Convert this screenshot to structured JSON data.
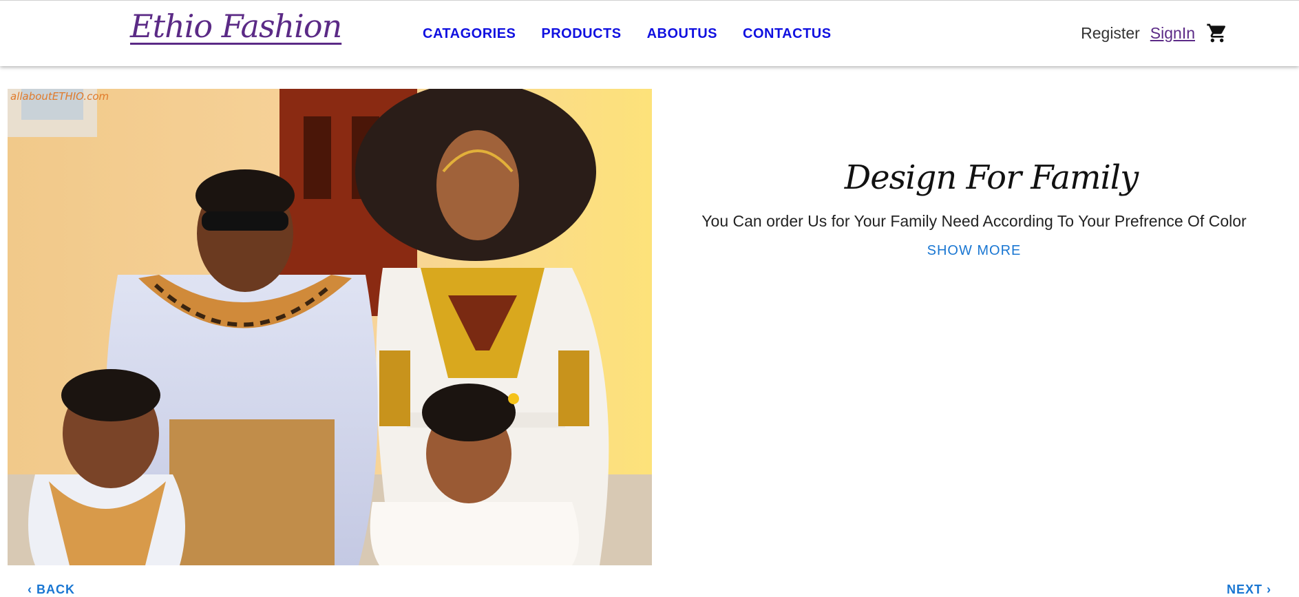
{
  "header": {
    "logo": "Ethio Fashion",
    "nav": [
      "CATAGORIES",
      "PRODUCTS",
      "ABOUTUS",
      "CONTACTUS"
    ],
    "register_label": "Register",
    "signin_label": "SignIn",
    "cart_icon": "shopping-cart-icon"
  },
  "slide": {
    "image_watermark": "allaboutETHIO.com",
    "title": "Design For Family",
    "description": "You Can order Us for Your Family Need According To Your Prefrence Of Color",
    "button_label": "SHOW MORE"
  },
  "stepper": {
    "back_label": "BACK",
    "next_label": "NEXT",
    "back_icon": "chevron-left-icon",
    "next_icon": "chevron-right-icon"
  },
  "colors": {
    "brand": "#5b2a86",
    "nav": "#1010e0",
    "accent": "#1976d2"
  }
}
